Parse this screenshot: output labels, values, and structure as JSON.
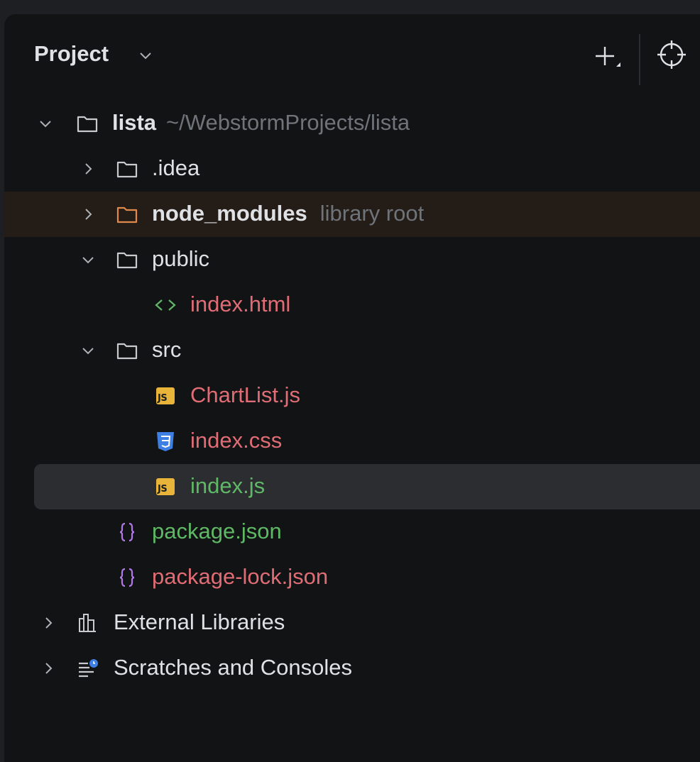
{
  "panel": {
    "title": "Project",
    "title_chevron_icon": "chevron-down-icon",
    "actions": [
      {
        "name": "new-item",
        "icon": "plus-icon"
      },
      {
        "name": "locate-file",
        "icon": "crosshair-target-icon"
      }
    ]
  },
  "colors": {
    "background": "#121314",
    "text": "#dfe1e5",
    "hint": "#6f737a",
    "modified_red": "#e06c75",
    "added_green": "#5fb865",
    "library_folder": "#e0894a",
    "selection": "#2b2d30"
  },
  "tree": {
    "root": {
      "label": "lista",
      "hint": "~/WebstormProjects/lista",
      "expanded": true,
      "icon": "folder-icon"
    },
    "items": [
      {
        "label": ".idea",
        "icon": "folder-icon",
        "expanded": false
      },
      {
        "label": "node_modules",
        "hint": "library root",
        "icon": "library-folder-icon",
        "expanded": false
      },
      {
        "label": "public",
        "icon": "folder-icon",
        "expanded": true
      },
      {
        "label": "index.html",
        "icon": "html-icon",
        "status": "modified"
      },
      {
        "label": "src",
        "icon": "folder-icon",
        "expanded": true
      },
      {
        "label": "ChartList.js",
        "icon": "js-icon",
        "badge": "JS",
        "status": "modified"
      },
      {
        "label": "index.css",
        "icon": "css-icon",
        "status": "modified"
      },
      {
        "label": "index.js",
        "icon": "js-icon",
        "badge": "JS",
        "status": "added",
        "selected": true
      },
      {
        "label": "package.json",
        "icon": "json-icon",
        "status": "added"
      },
      {
        "label": "package-lock.json",
        "icon": "json-icon",
        "status": "modified"
      }
    ],
    "extras": [
      {
        "label": "External Libraries",
        "icon": "libraries-icon",
        "expanded": false
      },
      {
        "label": "Scratches and Consoles",
        "icon": "scratches-icon",
        "expanded": false
      }
    ]
  }
}
